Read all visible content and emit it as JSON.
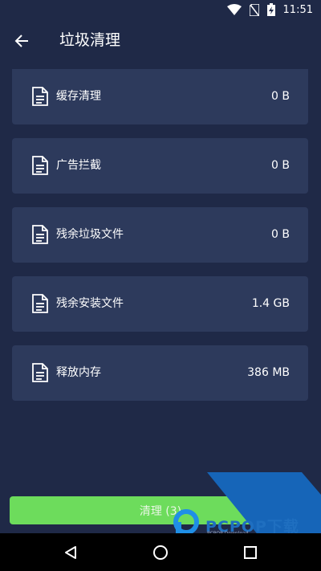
{
  "status_bar": {
    "time": "11:51",
    "icons": [
      "wifi-icon",
      "no-sim-icon",
      "battery-charging-icon"
    ]
  },
  "app_bar": {
    "back_icon": "arrow-left-icon",
    "title": "垃圾清理"
  },
  "items": [
    {
      "label": "缓存清理",
      "value": "0 B",
      "icon": "document-icon"
    },
    {
      "label": "广告拦截",
      "value": "0 B",
      "icon": "document-icon"
    },
    {
      "label": "残余垃圾文件",
      "value": "0 B",
      "icon": "document-icon"
    },
    {
      "label": "残余安装文件",
      "value": "1.4 GB",
      "icon": "document-icon"
    },
    {
      "label": "释放内存",
      "value": "386 MB",
      "icon": "document-icon"
    }
  ],
  "action": {
    "clean_label": "清理 (3)"
  },
  "watermark": {
    "text": "PCPOP下载",
    "sub": "PCPOP Download"
  },
  "nav": {
    "icons": [
      "back-triangle-icon",
      "home-circle-icon",
      "recents-square-icon"
    ]
  },
  "colors": {
    "background": "#1f2947",
    "card": "#2d3a5c",
    "accent_green": "#6ddc5c",
    "watermark_blue": "#1f6fc0"
  }
}
